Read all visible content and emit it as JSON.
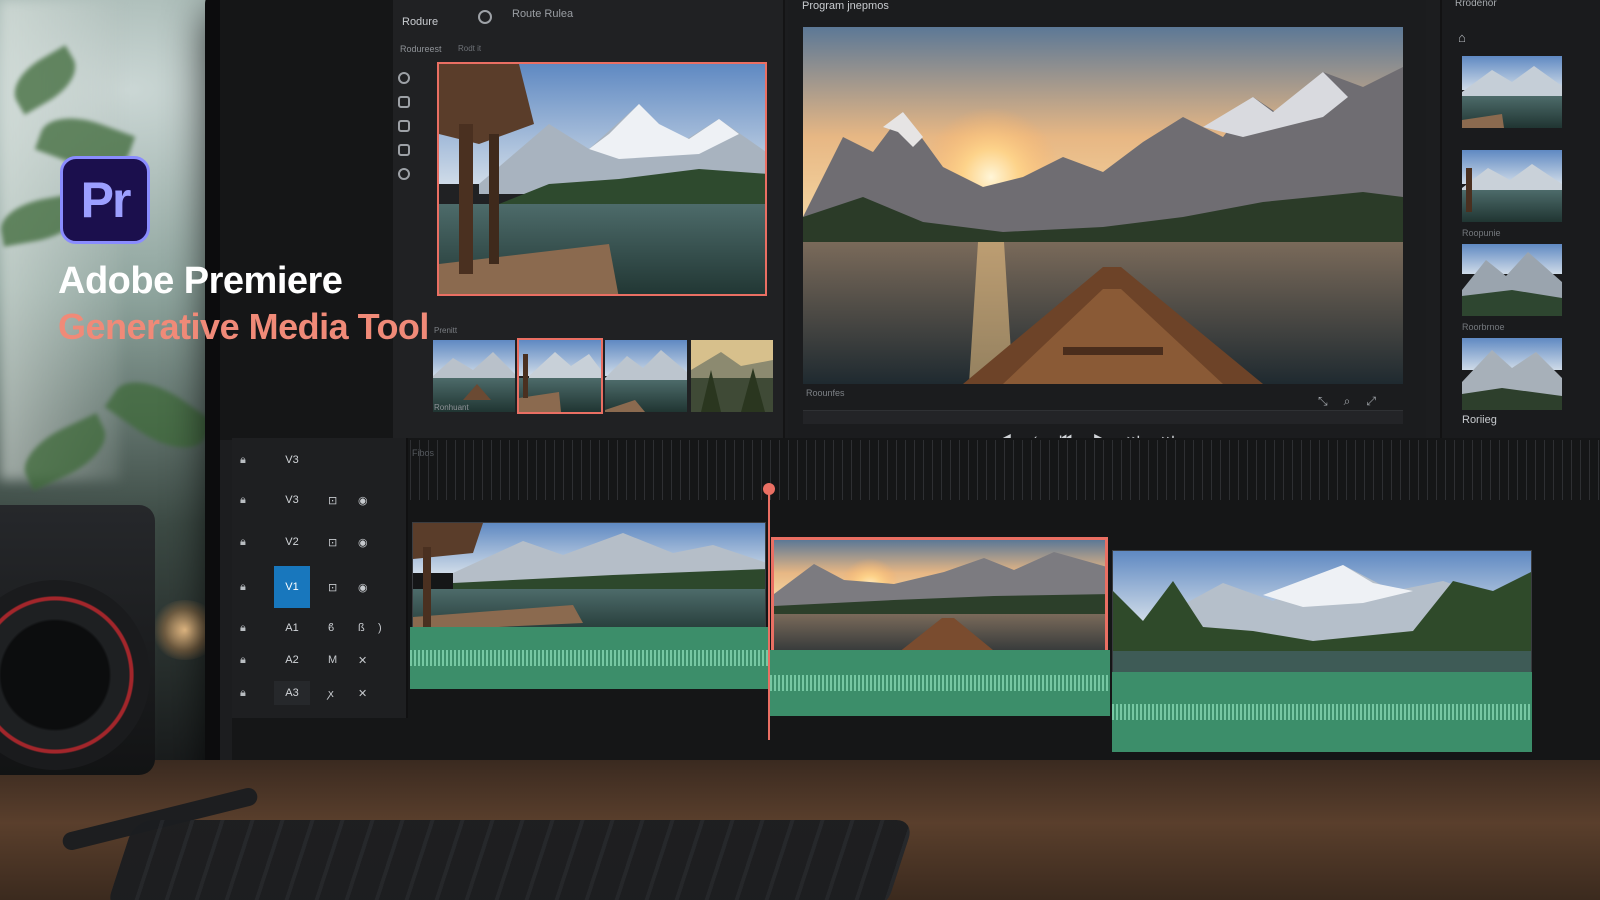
{
  "brand": {
    "logo_text": "Pr",
    "title": "Adobe Premiere",
    "subtitle": "Generative Media Tool"
  },
  "source_panel": {
    "tab_active": "Rodure",
    "tab_secondary": "Route Rulea",
    "sub_label": "Rodureest",
    "sub_label_2": "Rodt it",
    "thumbs_label": "Prenitt",
    "thumbs": [
      {
        "caption": "Ronhuant"
      },
      {
        "caption": ""
      },
      {
        "caption": ""
      },
      {
        "caption": ""
      }
    ],
    "tools": [
      "person-icon",
      "layers-icon",
      "film-icon",
      "user-icon",
      "circle-icon"
    ]
  },
  "program_monitor": {
    "title": "Program jnepmos",
    "meta_label": "Roounfes"
  },
  "right_panel": {
    "title": "Rrodenor",
    "labels": [
      "Roopunie",
      "Roorbrnoe"
    ],
    "bright_label": "Roriieg"
  },
  "timeline": {
    "ruler_label": "Fibos",
    "tracks": [
      {
        "name": "V3",
        "type": "video",
        "active": false,
        "icons": []
      },
      {
        "name": "V3",
        "type": "video",
        "active": false,
        "icons": [
          "lock-icon",
          "eye-icon"
        ]
      },
      {
        "name": "V2",
        "type": "video",
        "active": false,
        "icons": [
          "lock-icon",
          "eye-icon"
        ]
      },
      {
        "name": "V1",
        "type": "video",
        "active": true,
        "icons": [
          "lock-icon",
          "eye-icon"
        ]
      },
      {
        "name": "A1",
        "type": "audio",
        "active": false,
        "icons": [
          "mic-icon",
          "solo-icon",
          "ear-icon"
        ]
      },
      {
        "name": "A2",
        "type": "audio",
        "active": false,
        "icons": [
          "mute-icon",
          "cut-icon"
        ]
      },
      {
        "name": "A3",
        "type": "audio",
        "active": false,
        "icons": [
          "mute-icon",
          "cut-icon"
        ]
      }
    ]
  },
  "colors": {
    "accent": "#ea6f63",
    "active_track": "#1877bd",
    "audio": "#3c8e6a",
    "premiere_bg": "#1b0f4d",
    "premiere_border": "#8a8cff"
  }
}
